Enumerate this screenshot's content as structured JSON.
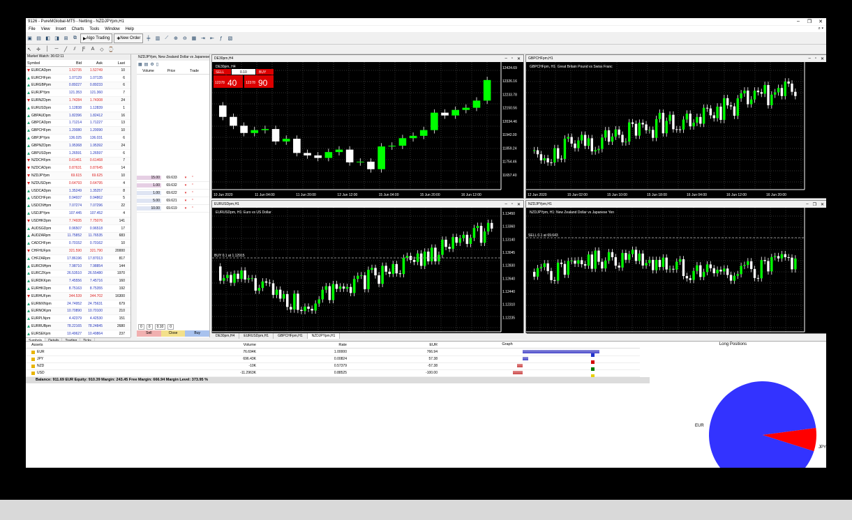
{
  "window": {
    "title": "9126 - PureMGlobal-MT5 - Netting - NZDJPYpm,H1",
    "controls": [
      "–",
      "❐",
      "✕"
    ]
  },
  "menu": [
    "File",
    "View",
    "Insert",
    "Charts",
    "Tools",
    "Window",
    "Help"
  ],
  "toolbar": {
    "algo_trading": "Algo Trading",
    "new_order": "New Order"
  },
  "market_watch": {
    "title": "Market Watch: 36:02:11",
    "headers": {
      "symbol": "Symbol",
      "bid": "Bid",
      "ask": "Ask",
      "last": "Last",
      "spread": "!"
    },
    "rows": [
      [
        "EURCADpm",
        "1.52735",
        "1.52749",
        "10",
        "dn"
      ],
      [
        "EURCHFpm",
        "1.07129",
        "1.07135",
        "6",
        "up"
      ],
      [
        "EURGBPpm",
        "0.89227",
        "0.89233",
        "6",
        "up"
      ],
      [
        "EURJPYpm",
        "121.353",
        "121.360",
        "7",
        "up"
      ],
      [
        "EURNZDpm",
        "1.74284",
        "1.74308",
        "24",
        "dn"
      ],
      [
        "EURUSDpm",
        "1.12838",
        "1.12839",
        "1",
        "up"
      ],
      [
        "GBPAUDpm",
        "1.82396",
        "1.82412",
        "16",
        "up"
      ],
      [
        "GBPCADpm",
        "1.71214",
        "1.71227",
        "13",
        "up"
      ],
      [
        "GBPCHFpm",
        "1.20080",
        "1.20090",
        "10",
        "up"
      ],
      [
        "GBPJPYpm",
        "136.025",
        "136.031",
        "6",
        "up"
      ],
      [
        "GBPNZDpm",
        "1.95368",
        "1.95392",
        "24",
        "up"
      ],
      [
        "GBPUSDpm",
        "1.26591",
        "1.26597",
        "6",
        "up"
      ],
      [
        "NZDCHFpm",
        "0.61461",
        "0.61468",
        "7",
        "dn"
      ],
      [
        "NZDCADpm",
        "0.87631",
        "0.87645",
        "14",
        "dn"
      ],
      [
        "NZDJPYpm",
        "69.615",
        "69.625",
        "10",
        "dn"
      ],
      [
        "NZDUSDpm",
        "0.64793",
        "0.64795",
        "4",
        "dn"
      ],
      [
        "USDCADpm",
        "1.35249",
        "1.35257",
        "8",
        "up"
      ],
      [
        "USDCHFpm",
        "0.94937",
        "0.94862",
        "5",
        "up"
      ],
      [
        "USDCNHpm",
        "7.07274",
        "7.07296",
        "22",
        "up"
      ],
      [
        "USDJPYpm",
        "107.445",
        "107.452",
        "4",
        "up"
      ],
      [
        "USDHKDpm",
        "7.74935",
        "7.75076",
        "141",
        "dn"
      ],
      [
        "AUDSGDpm",
        "0.96507",
        "0.96518",
        "17",
        "up"
      ],
      [
        "AUDZARpm",
        "11.75852",
        "11.76535",
        "683",
        "up"
      ],
      [
        "CADCHFpm",
        "0.70152",
        "0.70162",
        "10",
        "up"
      ],
      [
        "CHFHUFpm",
        "321.590",
        "321.790",
        "20000",
        "dn"
      ],
      [
        "CHFZARpm",
        "17.86196",
        "17.87013",
        "817",
        "up"
      ],
      [
        "EURCNHpm",
        "7.98710",
        "7.98854",
        "144",
        "up"
      ],
      [
        "EURCZKpm",
        "26.53510",
        "26.55480",
        "1970",
        "up"
      ],
      [
        "EURDKKpm",
        "7.45556",
        "7.45716",
        "160",
        "up"
      ],
      [
        "EURHKDpm",
        "8.75163",
        "8.75355",
        "192",
        "up"
      ],
      [
        "EURHUFpm",
        "344.539",
        "344.702",
        "16300",
        "dn"
      ],
      [
        "EURMXNpm",
        "24.74952",
        "24.75631",
        "679",
        "up"
      ],
      [
        "EURNOKpm",
        "10.70890",
        "10.70100",
        "210",
        "up"
      ],
      [
        "EURPLNpm",
        "4.42379",
        "4.42530",
        "151",
        "up"
      ],
      [
        "EURRUBpm",
        "78.22165",
        "78.24845",
        "2680",
        "up"
      ],
      [
        "EURSEKpm",
        "10.49627",
        "10.49864",
        "237",
        "up"
      ],
      [
        "EURSGDpm",
        "1.57034",
        "1.57062",
        "18",
        "up"
      ],
      [
        "EURTRYpm",
        "7.72901",
        "7.73211",
        "310",
        "up"
      ]
    ],
    "tabs": [
      "Symbols",
      "Details",
      "Trading",
      "Ticks"
    ]
  },
  "depth": {
    "title": "NZDJPYpm, New Zealand Dollar vs Japanese Yen",
    "headers": {
      "volume": "Volume",
      "price": "Price",
      "trade": "Trade"
    },
    "rows": [
      {
        "vol": "15.00",
        "price": "69.633",
        "side": "ask"
      },
      {
        "vol": "1.00",
        "price": "69.632",
        "side": "ask"
      },
      {
        "vol": "1.00",
        "price": "69.622",
        "side": "bid"
      },
      {
        "vol": "5.00",
        "price": "69.621",
        "side": "bid"
      },
      {
        "vol": "10.00",
        "price": "69.619",
        "side": "bid"
      }
    ],
    "inputs": [
      "0",
      "0",
      "0.10",
      "0"
    ],
    "buttons": {
      "sell": "Sell",
      "close": "Close",
      "buy": "Buy"
    }
  },
  "charts": [
    {
      "name": "DE30pm,H4",
      "label": "DE30pm, H4",
      "trade": {
        "sell": "SELL",
        "buy": "BUY",
        "lot": "0.10",
        "sell_big": "40",
        "buy_big": "90",
        "sell_small": "12378",
        "buy_small": "12378"
      },
      "prices": [
        "12424.69",
        "12326.16",
        "12233.78",
        "12150.56",
        "12034.46",
        "11942.00",
        "11859.24",
        "11754.46",
        "11657.40"
      ],
      "dates": [
        "10 Jun 2020",
        "11 Jun 04:00",
        "11 Jun 20:00",
        "12 Jun 12:00",
        "15 Jun 04:00",
        "15 Jun 20:00",
        "16 Jun 12:00"
      ]
    },
    {
      "name": "GBPCHFpm,H1",
      "label": "GBPCHFpm, H1:  Great Britain Pound vs Swiss Franc",
      "dates": [
        "12 Jun 2020",
        "15 Jun 02:00",
        "15 Jun 10:00",
        "15 Jun 18:00",
        "16 Jun 04:00",
        "16 Jun 12:00",
        "16 Jun 20:00"
      ]
    },
    {
      "name": "EURUSDpm,H1",
      "label": "EURUSDpm, H1:  Euro vs US Dollar",
      "level_label": "BUY 0.1 at 1.12915",
      "prices": [
        "1.13450",
        "1.13360",
        "1.13140",
        "1.13045",
        "1.12830",
        "1.12640",
        "1.12440",
        "1.12310",
        "1.12235"
      ]
    },
    {
      "name": "NZDJPYpm,H1",
      "label": "NZDJPYpm, H1:  New Zealand Dollar vs Japanese Yen",
      "level_label": "SELL 0.1 at 69.643"
    }
  ],
  "chart_tabs": [
    "DE30pm,H4",
    "EURUSDpm,H1",
    "GBPCHFpm,H1",
    "NZDJPYpm,H1"
  ],
  "exposure": {
    "headers": {
      "assets": "Assets",
      "volume": "Volume",
      "rate": "Rate",
      "eur": "EUR",
      "graph": "Graph"
    },
    "rows": [
      {
        "asset": "EUR",
        "volume": "76.694K",
        "rate": "1.00000",
        "eur": "766.94",
        "bar": 0.92,
        "dir": "pos",
        "color": "#2233cc"
      },
      {
        "asset": "JPY",
        "volume": "696.43K",
        "rate": "0.00824",
        "eur": "57.38",
        "bar": 0.07,
        "dir": "pos",
        "color": "#d40000"
      },
      {
        "asset": "NZD",
        "volume": "-10K",
        "rate": "0.57379",
        "eur": "-57.38",
        "bar": 0.07,
        "dir": "neg",
        "color": "#007a00"
      },
      {
        "asset": "USD",
        "volume": "-11.2963K",
        "rate": "0.88525",
        "eur": "-100.00",
        "bar": 0.12,
        "dir": "neg",
        "color": "#e8d000"
      }
    ],
    "balance": "Balance: 911.69 EUR  Equity: 910.39  Margin: 243.45  Free Margin: 666.94  Margin Level: 373.95 %"
  },
  "chart_data": {
    "type": "pie",
    "title": "Long Positions",
    "series": [
      {
        "values": [
          766.94,
          57.38
        ]
      }
    ],
    "categories": [
      "EUR",
      "JPY"
    ],
    "colors": [
      "#3333ff",
      "#ff0000"
    ]
  }
}
